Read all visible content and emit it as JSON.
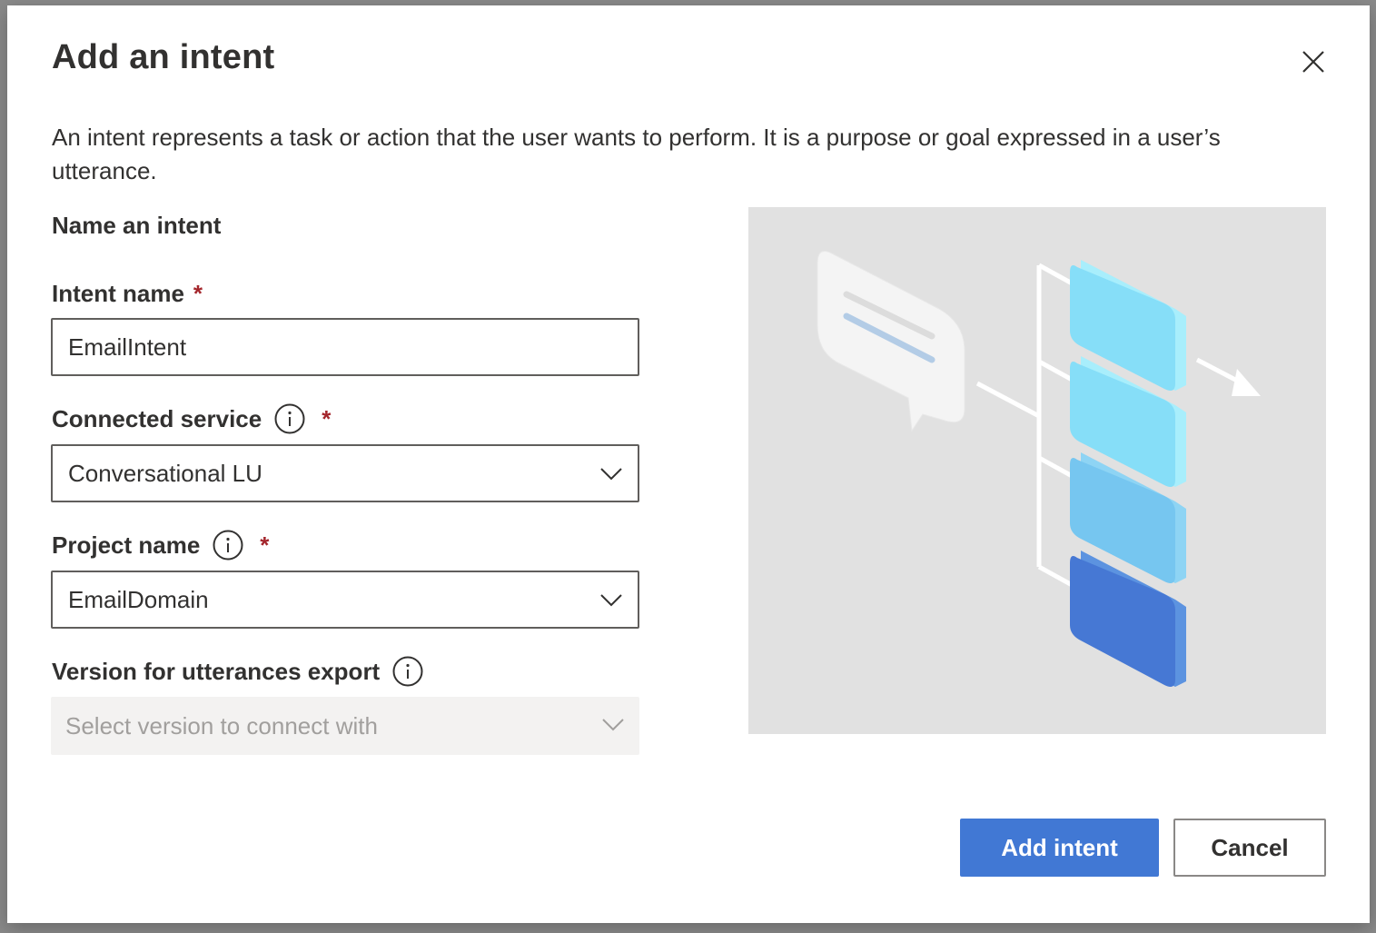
{
  "dialog": {
    "title": "Add an intent",
    "description": "An intent represents a task or action that the user wants to perform. It is a purpose or goal expressed in a user’s utterance.",
    "section_title": "Name an intent"
  },
  "fields": {
    "intent_name": {
      "label": "Intent name",
      "required_mark": "*",
      "value": "EmailIntent"
    },
    "connected_service": {
      "label": "Connected service",
      "required_mark": "*",
      "value": "Conversational LU"
    },
    "project_name": {
      "label": "Project name",
      "required_mark": "*",
      "value": "EmailDomain"
    },
    "version": {
      "label": "Version for utterances export",
      "placeholder": "Select version to connect with"
    }
  },
  "buttons": {
    "primary": "Add intent",
    "secondary": "Cancel"
  },
  "colors": {
    "primary": "#4178d4",
    "required": "#a4262c",
    "illustration_bg": "#e1e1e1"
  },
  "icons": [
    "close-icon",
    "info-icon",
    "chevron-down-icon"
  ]
}
